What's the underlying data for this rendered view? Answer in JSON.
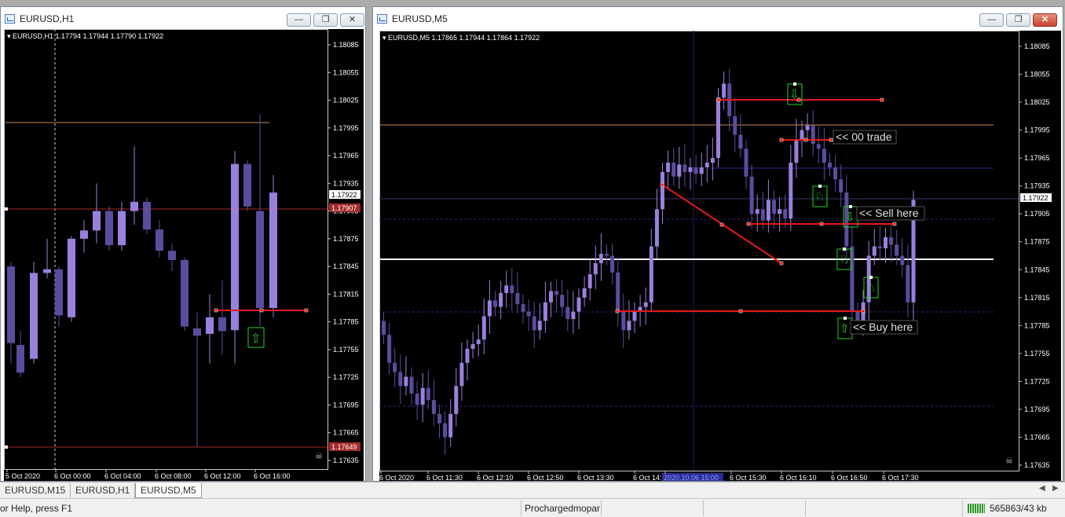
{
  "left_window": {
    "title": "EURUSD,H1",
    "header": "EURUSD,H1  1.17794 1.17944 1.17790 1.17922",
    "price_axis": [
      "1.18085",
      "1.18055",
      "1.18025",
      "1.17995",
      "1.17965",
      "1.17935",
      "1.17905",
      "1.17875",
      "1.17845",
      "1.17815",
      "1.17785",
      "1.17755",
      "1.17725",
      "1.17695",
      "1.17665",
      "1.17635"
    ],
    "current_price": "1.17922",
    "red_level_price": "1.17907",
    "bottom_level_price": "1.17649",
    "time_axis": [
      "5 Oct 2020",
      "6 Oct 00:00",
      "6 Oct 04:00",
      "6 Oct 08:00",
      "6 Oct 12:00",
      "6 Oct 16:00"
    ]
  },
  "right_window": {
    "title": "EURUSD,M5",
    "header": "EURUSD,M5  1.17865 1.17944 1.17864 1.17922",
    "price_axis": [
      "1.18085",
      "1.18055",
      "1.18025",
      "1.17995",
      "1.17965",
      "1.17935",
      "1.17905",
      "1.17875",
      "1.17845",
      "1.17815",
      "1.17785",
      "1.17755",
      "1.17725",
      "1.17695",
      "1.17665",
      "1.17635"
    ],
    "current_price": "1.17922",
    "time_axis": [
      "6 Oct 2020",
      "6 Oct 11:30",
      "6 Oct 12:10",
      "6 Oct 12:50",
      "6 Oct 13:30",
      "6 Oct 14:1",
      "2020.10.06 15:00",
      "6 Oct 15:30",
      "6 Oct 16:10",
      "6 Oct 16:50",
      "6 Oct 17:30"
    ],
    "annotations": {
      "trade": "<< 00 trade",
      "sell": "<< Sell here",
      "buy": "<< Buy here"
    }
  },
  "window_controls": {
    "minimize": "—",
    "restore": "❐",
    "close": "✕"
  },
  "tabs": [
    "EURUSD,M15",
    "EURUSD,H1",
    "EURUSD,M5"
  ],
  "active_tab": "EURUSD,M5",
  "tab_scroll": {
    "left": "◀",
    "right": "▶"
  },
  "status": {
    "help": "or Help, press F1",
    "profile": "Prochargedmopar",
    "traffic": "565863/43 kb"
  },
  "colors": {
    "bull": "#9a80dd",
    "bear": "#5b4d9e",
    "line_red": "#e21a1a",
    "signal_green": "#22d322",
    "grid_blue": "#1c1c6a"
  }
}
